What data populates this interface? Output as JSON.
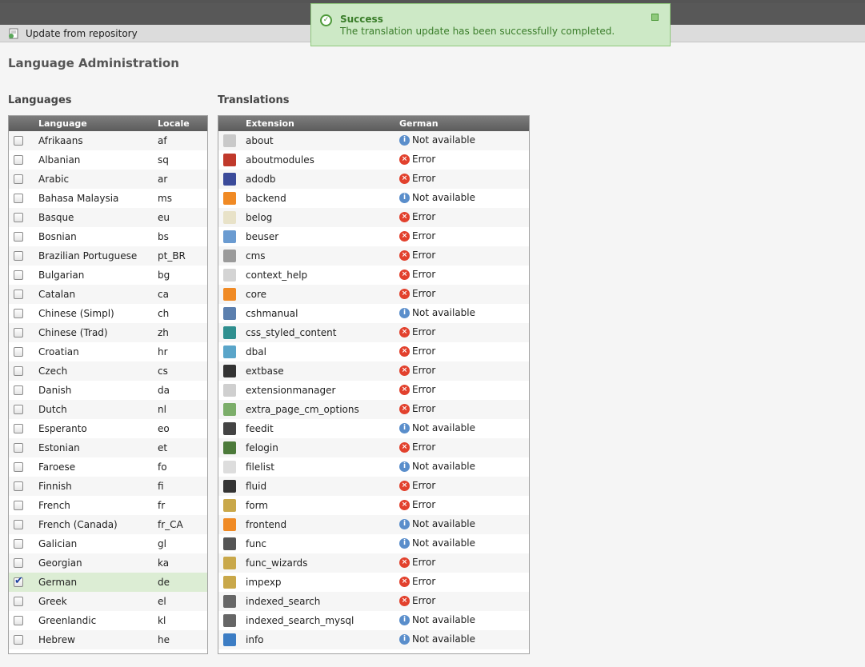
{
  "toolbar": {
    "update_label": "Update from repository"
  },
  "page": {
    "title": "Language Administration"
  },
  "flash": {
    "title": "Success",
    "message": "The translation update has been successfully completed."
  },
  "languages": {
    "heading": "Languages",
    "col_language": "Language",
    "col_locale": "Locale",
    "rows": [
      {
        "name": "Afrikaans",
        "locale": "af",
        "checked": false
      },
      {
        "name": "Albanian",
        "locale": "sq",
        "checked": false
      },
      {
        "name": "Arabic",
        "locale": "ar",
        "checked": false
      },
      {
        "name": "Bahasa Malaysia",
        "locale": "ms",
        "checked": false
      },
      {
        "name": "Basque",
        "locale": "eu",
        "checked": false
      },
      {
        "name": "Bosnian",
        "locale": "bs",
        "checked": false
      },
      {
        "name": "Brazilian Portuguese",
        "locale": "pt_BR",
        "checked": false
      },
      {
        "name": "Bulgarian",
        "locale": "bg",
        "checked": false
      },
      {
        "name": "Catalan",
        "locale": "ca",
        "checked": false
      },
      {
        "name": "Chinese (Simpl)",
        "locale": "ch",
        "checked": false
      },
      {
        "name": "Chinese (Trad)",
        "locale": "zh",
        "checked": false
      },
      {
        "name": "Croatian",
        "locale": "hr",
        "checked": false
      },
      {
        "name": "Czech",
        "locale": "cs",
        "checked": false
      },
      {
        "name": "Danish",
        "locale": "da",
        "checked": false
      },
      {
        "name": "Dutch",
        "locale": "nl",
        "checked": false
      },
      {
        "name": "Esperanto",
        "locale": "eo",
        "checked": false
      },
      {
        "name": "Estonian",
        "locale": "et",
        "checked": false
      },
      {
        "name": "Faroese",
        "locale": "fo",
        "checked": false
      },
      {
        "name": "Finnish",
        "locale": "fi",
        "checked": false
      },
      {
        "name": "French",
        "locale": "fr",
        "checked": false
      },
      {
        "name": "French (Canada)",
        "locale": "fr_CA",
        "checked": false
      },
      {
        "name": "Galician",
        "locale": "gl",
        "checked": false
      },
      {
        "name": "Georgian",
        "locale": "ka",
        "checked": false
      },
      {
        "name": "German",
        "locale": "de",
        "checked": true
      },
      {
        "name": "Greek",
        "locale": "el",
        "checked": false
      },
      {
        "name": "Greenlandic",
        "locale": "kl",
        "checked": false
      },
      {
        "name": "Hebrew",
        "locale": "he",
        "checked": false
      }
    ]
  },
  "translations": {
    "heading": "Translations",
    "col_extension": "Extension",
    "col_language": "German",
    "rows": [
      {
        "ext": "about",
        "status": "Not available",
        "kind": "na",
        "icon_color": "#c9c9c9"
      },
      {
        "ext": "aboutmodules",
        "status": "Error",
        "kind": "err",
        "icon_color": "#c0392b"
      },
      {
        "ext": "adodb",
        "status": "Error",
        "kind": "err",
        "icon_color": "#3b4b9a"
      },
      {
        "ext": "backend",
        "status": "Not available",
        "kind": "na",
        "icon_color": "#f08a24"
      },
      {
        "ext": "belog",
        "status": "Error",
        "kind": "err",
        "icon_color": "#e8e2c8"
      },
      {
        "ext": "beuser",
        "status": "Error",
        "kind": "err",
        "icon_color": "#6a9bd1"
      },
      {
        "ext": "cms",
        "status": "Error",
        "kind": "err",
        "icon_color": "#9a9a9a"
      },
      {
        "ext": "context_help",
        "status": "Error",
        "kind": "err",
        "icon_color": "#d4d4d4"
      },
      {
        "ext": "core",
        "status": "Error",
        "kind": "err",
        "icon_color": "#f08a24"
      },
      {
        "ext": "cshmanual",
        "status": "Not available",
        "kind": "na",
        "icon_color": "#5b7fae"
      },
      {
        "ext": "css_styled_content",
        "status": "Error",
        "kind": "err",
        "icon_color": "#2f8f8f"
      },
      {
        "ext": "dbal",
        "status": "Error",
        "kind": "err",
        "icon_color": "#5aa5c9"
      },
      {
        "ext": "extbase",
        "status": "Error",
        "kind": "err",
        "icon_color": "#333333"
      },
      {
        "ext": "extensionmanager",
        "status": "Error",
        "kind": "err",
        "icon_color": "#cfcfcf"
      },
      {
        "ext": "extra_page_cm_options",
        "status": "Error",
        "kind": "err",
        "icon_color": "#7cae6a"
      },
      {
        "ext": "feedit",
        "status": "Not available",
        "kind": "na",
        "icon_color": "#444444"
      },
      {
        "ext": "felogin",
        "status": "Error",
        "kind": "err",
        "icon_color": "#4c7a3a"
      },
      {
        "ext": "filelist",
        "status": "Not available",
        "kind": "na",
        "icon_color": "#dddddd"
      },
      {
        "ext": "fluid",
        "status": "Error",
        "kind": "err",
        "icon_color": "#333333"
      },
      {
        "ext": "form",
        "status": "Error",
        "kind": "err",
        "icon_color": "#c9a84a"
      },
      {
        "ext": "frontend",
        "status": "Not available",
        "kind": "na",
        "icon_color": "#f08a24"
      },
      {
        "ext": "func",
        "status": "Not available",
        "kind": "na",
        "icon_color": "#555555"
      },
      {
        "ext": "func_wizards",
        "status": "Error",
        "kind": "err",
        "icon_color": "#c9a84a"
      },
      {
        "ext": "impexp",
        "status": "Error",
        "kind": "err",
        "icon_color": "#c9a84a"
      },
      {
        "ext": "indexed_search",
        "status": "Error",
        "kind": "err",
        "icon_color": "#666666"
      },
      {
        "ext": "indexed_search_mysql",
        "status": "Not available",
        "kind": "na",
        "icon_color": "#666666"
      },
      {
        "ext": "info",
        "status": "Not available",
        "kind": "na",
        "icon_color": "#3c7dc4"
      }
    ]
  }
}
